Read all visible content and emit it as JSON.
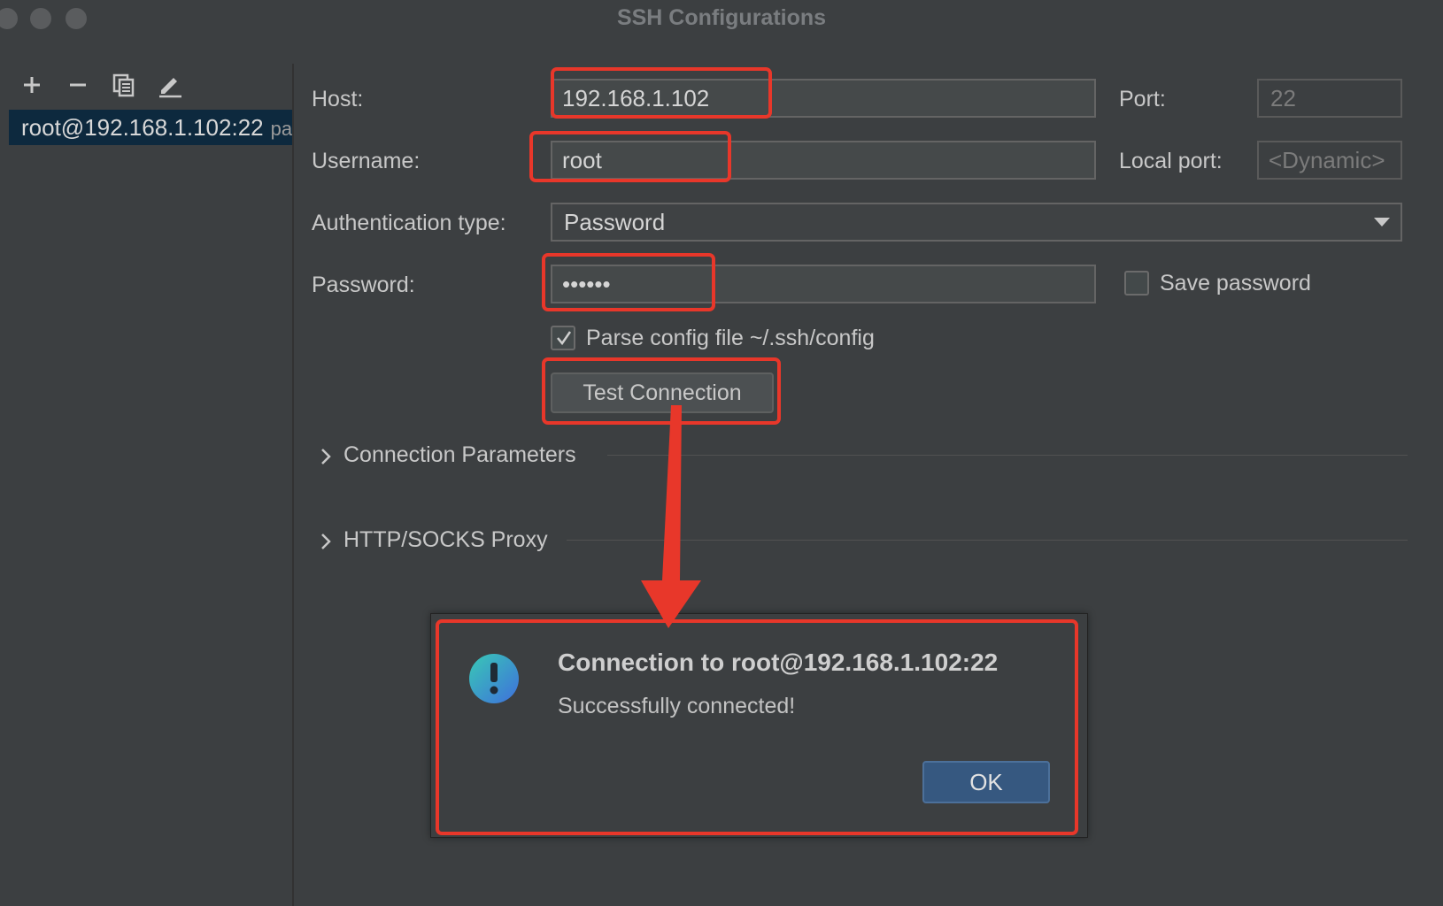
{
  "window": {
    "title": "SSH Configurations"
  },
  "toolbar": {
    "add_icon": "plus-icon",
    "remove_icon": "minus-icon",
    "copy_icon": "copy-icon",
    "edit_icon": "pencil-icon"
  },
  "sidebar": {
    "items": [
      {
        "label": "root@192.168.1.102:22",
        "suffix": "pa"
      }
    ]
  },
  "form": {
    "host_label": "Host:",
    "host_value": "192.168.1.102",
    "port_label": "Port:",
    "port_value": "22",
    "username_label": "Username:",
    "username_value": "root",
    "local_port_label": "Local port:",
    "local_port_value": "<Dynamic>",
    "auth_type_label": "Authentication type:",
    "auth_type_value": "Password",
    "password_label": "Password:",
    "password_value": "••••••",
    "save_password_label": "Save password",
    "save_password_checked": false,
    "parse_config_label": "Parse config file ~/.ssh/config",
    "parse_config_checked": true,
    "test_connection_label": "Test Connection",
    "sections": [
      {
        "label": "Connection Parameters"
      },
      {
        "label": "HTTP/SOCKS Proxy"
      }
    ]
  },
  "dialog": {
    "icon": "info-exclamation-icon",
    "title": "Connection to root@192.168.1.102:22",
    "message": "Successfully connected!",
    "ok_label": "OK"
  },
  "colors": {
    "annotation": "#e8372a",
    "primary_button": "#365880",
    "selection": "#0d293e",
    "background": "#3c3f41"
  }
}
